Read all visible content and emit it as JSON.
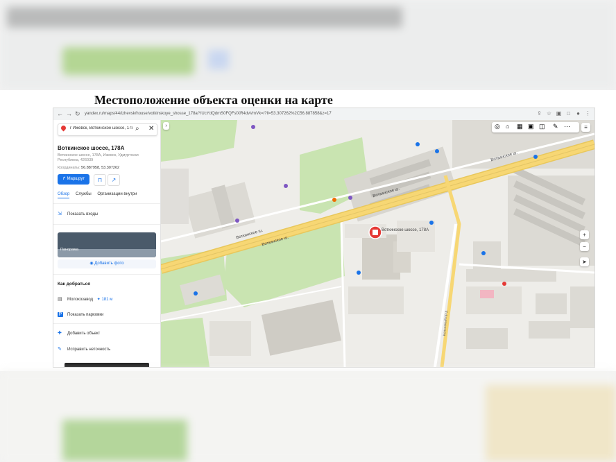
{
  "document": {
    "title": "Местоположение объекта оценки на карте"
  },
  "browser": {
    "url": "yandex.ru/maps/44/izhevsk/house/votkinskoye_shosse_178a/YUcYdQdmS0FQFsfXR4dvVmVk=/?ll=53.307262%2C56.887858&z=17"
  },
  "sidebar": {
    "search_value": "г Ижевск, Воткинское шоссе, 178",
    "place_title": "Воткинское шоссе, 178А",
    "address": "Воткинское шоссе, 178А, Ижевск, Удмуртская Республика, 426039",
    "coords_label": "Координаты:",
    "coords_value": "56.887958, 53.307262",
    "route_label": "Маршрут",
    "tabs": [
      "Обзор",
      "Службы",
      "Организации внутри"
    ],
    "show_entrances": "Показать входы",
    "panorama_label": "Панорама",
    "add_photo": "Добавить фото",
    "how_to_get": "Как добраться",
    "nearest_stop": "Молокозавод",
    "nearest_stop_dist": "181 м",
    "show_parking": "Показать парковки",
    "add_object": "Добавить объект",
    "fix_inaccuracy": "Исправить неточность"
  },
  "map": {
    "target_label": "Воткинское шоссе, 178А",
    "road_label_1": "Воткинское ш.",
    "road_label_2": "Воткинское ш.",
    "road_label_3": "Воткинское ш.",
    "road_label_4": "Воткинское ш.",
    "side_street": "Колхозный пр-д"
  },
  "colors": {
    "road": "#f7d774",
    "park": "#c9e4b1",
    "building": "#dcdad4",
    "accent": "#1a73e8",
    "marker": "#e53935"
  }
}
